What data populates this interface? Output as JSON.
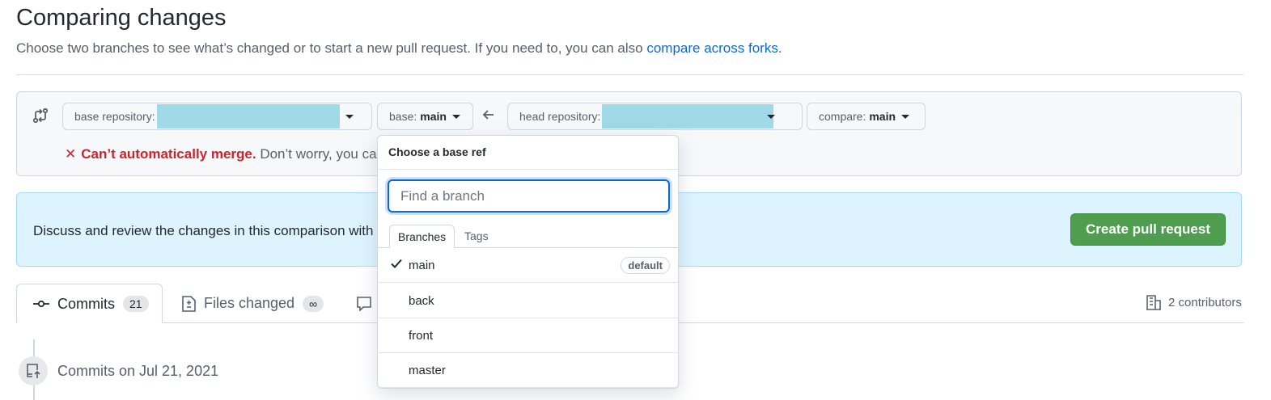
{
  "header": {
    "title": "Comparing changes",
    "subtitle": "Choose two branches to see what’s changed or to start a new pull request. If you need to, you can also ",
    "subtitle_link": "compare across forks",
    "subtitle_end": "."
  },
  "range": {
    "base_repo_label": "base repository:",
    "base_label": "base:",
    "base_value": "main",
    "head_repo_label": "head repository:",
    "compare_label": "compare:",
    "compare_value": "main"
  },
  "merge": {
    "x": "✕",
    "status": "Can’t automatically merge.",
    "detail": "Don’t worry, you ca"
  },
  "discuss": {
    "text": "Discuss and review the changes in this comparison with",
    "create_button": "Create pull request"
  },
  "tabs": {
    "commits_label": "Commits",
    "commits_count": "21",
    "files_label": "Files changed",
    "files_count": "∞",
    "contributors": "2 contributors"
  },
  "timeline": {
    "date_label": "Commits on Jul 21, 2021"
  },
  "dropdown": {
    "title": "Choose a base ref",
    "search_placeholder": "Find a branch",
    "tab_branches": "Branches",
    "tab_tags": "Tags",
    "branches": [
      {
        "name": "main",
        "selected": true,
        "badge": "default"
      },
      {
        "name": "back",
        "selected": false,
        "badge": ""
      },
      {
        "name": "front",
        "selected": false,
        "badge": ""
      },
      {
        "name": "master",
        "selected": false,
        "badge": ""
      }
    ]
  },
  "colors": {
    "link": "#0969da",
    "error": "#cf222e",
    "primary_button": "#4f9e4f",
    "info_bg": "#ddf4ff",
    "redacted": "#a0d9e8"
  }
}
